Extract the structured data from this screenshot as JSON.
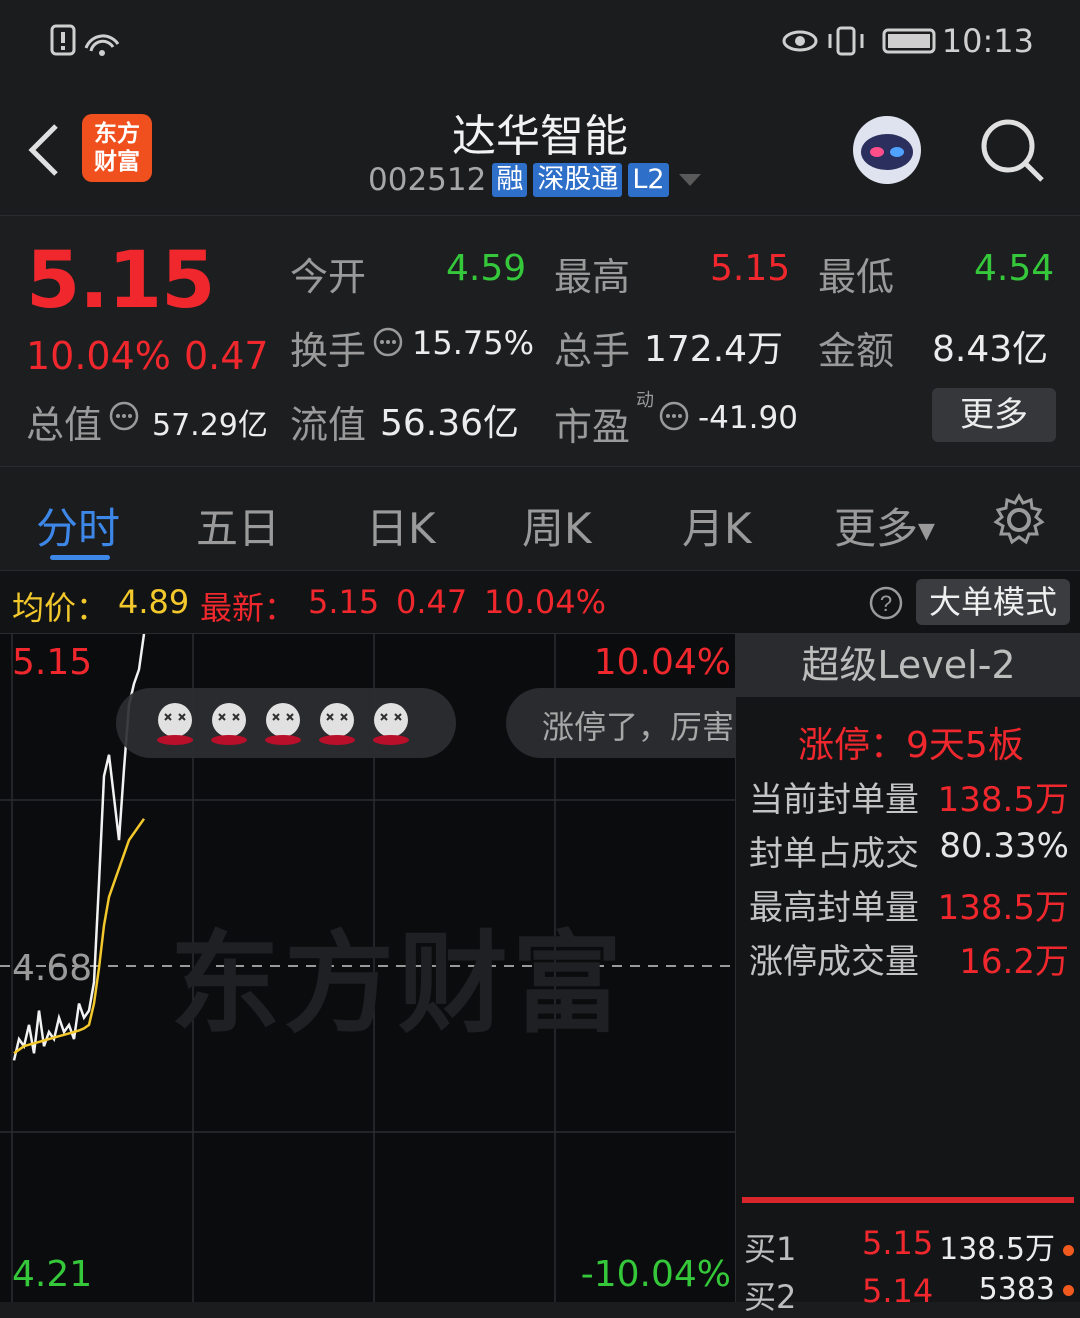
{
  "status_bar": {
    "time": "10:13"
  },
  "header": {
    "logo_text_line1": "东方",
    "logo_text_line2": "财富",
    "title": "达华智能",
    "code": "002512",
    "tags": [
      "融",
      "深股通",
      "L2"
    ]
  },
  "quote": {
    "price": "5.15",
    "change_pct": "10.04%",
    "change": "0.47",
    "open_label": "今开",
    "open": "4.59",
    "high_label": "最高",
    "high": "5.15",
    "low_label": "最低",
    "low": "4.54",
    "turnover_label": "换手",
    "turnover": "15.75%",
    "volume_label": "总手",
    "volume": "172.4万",
    "amount_label": "金额",
    "amount": "8.43亿",
    "total_cap_label": "总值",
    "total_cap": "57.29亿",
    "float_cap_label": "流值",
    "float_cap": "56.36亿",
    "pe_label": "市盈",
    "pe_sup": "动",
    "pe": "-41.90",
    "more_label": "更多"
  },
  "tabs": [
    "分时",
    "五日",
    "日K",
    "周K",
    "月K",
    "更多"
  ],
  "info_line": {
    "avg_label": "均价：",
    "avg": "4.89",
    "latest_label": "最新：",
    "latest": "5.15",
    "latest_change": "0.47",
    "latest_pct": "10.04%",
    "big_order_label": "大单模式"
  },
  "chart": {
    "top_price": "5.15",
    "top_pct": "10.04%",
    "mid_price": "4.68",
    "bottom_price": "4.21",
    "bottom_pct": "-10.04%",
    "watermark": "东方财富",
    "bubble_text": "涨停了，厉害",
    "emoji_count": 5
  },
  "chart_data": {
    "type": "line",
    "ylim": [
      4.21,
      5.15
    ],
    "series": [
      {
        "name": "price",
        "values": [
          4.55,
          4.58,
          4.57,
          4.6,
          4.56,
          4.62,
          4.57,
          4.59,
          4.58,
          4.61,
          4.59,
          4.6,
          4.58,
          4.63,
          4.61,
          4.62,
          4.66,
          4.8,
          4.95,
          4.98,
          4.92,
          4.86,
          4.96,
          5.05,
          5.08,
          5.1,
          5.15
        ]
      },
      {
        "name": "avg",
        "values": [
          4.56,
          4.565,
          4.57,
          4.572,
          4.574,
          4.576,
          4.578,
          4.58,
          4.582,
          4.584,
          4.586,
          4.588,
          4.59,
          4.592,
          4.595,
          4.6,
          4.63,
          4.68,
          4.74,
          4.78,
          4.8,
          4.82,
          4.84,
          4.86,
          4.87,
          4.88,
          4.89
        ]
      }
    ]
  },
  "level2": {
    "title": "超级Level-2",
    "limit_up_label": "涨停：",
    "limit_up_value": "9天5板",
    "rows": [
      {
        "label": "当前封单量",
        "value": "138.5万",
        "color": "#f0282d"
      },
      {
        "label": "封单占成交",
        "value": "80.33%",
        "color": "#e6e6e6"
      },
      {
        "label": "最高封单量",
        "value": "138.5万",
        "color": "#f0282d"
      },
      {
        "label": "涨停成交量",
        "value": "16.2万",
        "color": "#f0282d"
      }
    ],
    "book": [
      {
        "label": "买1",
        "price": "5.15",
        "vol": "138.5万"
      },
      {
        "label": "买2",
        "price": "5.14",
        "vol": "5383"
      }
    ]
  },
  "colors": {
    "up": "#f0282d",
    "down": "#34c83a",
    "accent": "#3d87e8",
    "avg_line": "#f3c82c"
  }
}
